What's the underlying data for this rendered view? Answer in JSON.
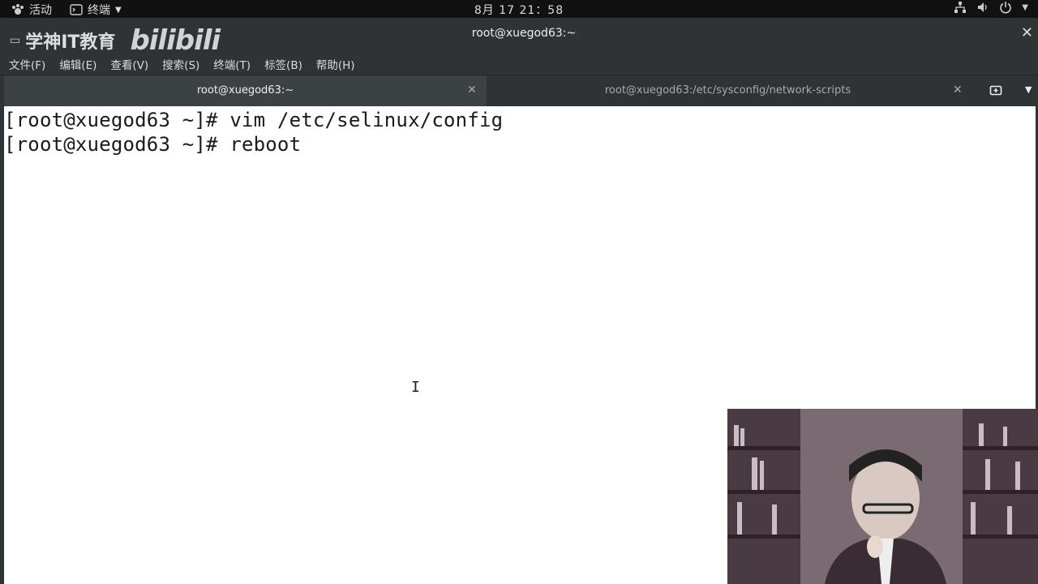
{
  "topbar": {
    "activities": "活动",
    "app_menu": "终端",
    "clock": "8月 17  21：58"
  },
  "window": {
    "title": "root@xuegod63:~",
    "watermark_text": "学神IT教育",
    "watermark_logo": "bilibili"
  },
  "menu": {
    "items": [
      "文件(F)",
      "编辑(E)",
      "查看(V)",
      "搜索(S)",
      "终端(T)",
      "标签(B)",
      "帮助(H)"
    ]
  },
  "tabs": [
    {
      "label": "root@xuegod63:~",
      "active": true
    },
    {
      "label": "root@xuegod63:/etc/sysconfig/network-scripts",
      "active": false
    }
  ],
  "terminal": {
    "lines": [
      "[root@xuegod63 ~]# vim /etc/selinux/config",
      "[root@xuegod63 ~]# reboot"
    ]
  },
  "colors": {
    "topbar_bg": "#111111",
    "chrome_bg": "#2f3335",
    "terminal_bg": "#ffffff",
    "terminal_fg": "#1a1a1a"
  }
}
